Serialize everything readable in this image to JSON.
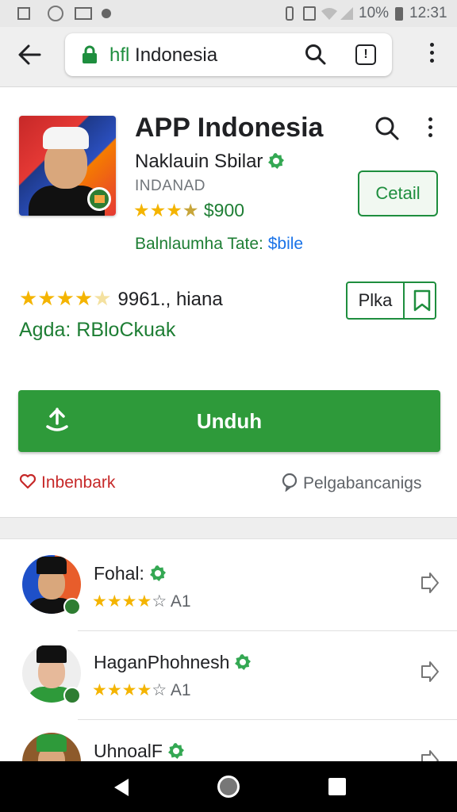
{
  "status_bar": {
    "battery": "10%",
    "time": "12:31"
  },
  "browser": {
    "url_prefix": "hfl",
    "url_domain": " Indonesia",
    "tab_count": "!"
  },
  "app": {
    "title": "APP Indonesia",
    "developer": "Naklauin Sbilar",
    "sub_label": "INDANAD",
    "rating_stars": "★★★",
    "rating_half": "★",
    "price": " $900",
    "tagline_main": "Balnlaumha Tate: ",
    "tagline_accent": "$bile",
    "detail_button": "Cetail"
  },
  "rating_block": {
    "stars": "★★★★",
    "star_pale": "★",
    "summary": "9961., hiana",
    "age": "Agda: RBloCkuak",
    "split_button": "Plka"
  },
  "install": {
    "label": "Unduh"
  },
  "actions": {
    "wishlist": "Inbenbark",
    "reviews": "Pelgabancanigs"
  },
  "list": [
    {
      "title": "Fohal:",
      "stars": "★★★★",
      "meta": " A1"
    },
    {
      "title": "HaganPhohnesh",
      "stars": "★★★★",
      "meta": " A1"
    },
    {
      "title": "UhnoalF",
      "stars": "",
      "meta": ""
    }
  ],
  "colors": {
    "accent_green": "#2e9a3a",
    "text_green": "#1e7e34",
    "star_gold": "#f4b400",
    "wishlist_red": "#c62828",
    "link_blue": "#1a73e8"
  },
  "icons": [
    "back-arrow-icon",
    "lock-icon",
    "search-icon",
    "tab-icon",
    "more-vert-icon",
    "verified-badge-icon",
    "bookmark-icon",
    "download-icon",
    "heart-icon",
    "chat-bubble-icon",
    "chevron-right-icon",
    "nav-back-icon",
    "nav-home-icon",
    "nav-recents-icon"
  ]
}
